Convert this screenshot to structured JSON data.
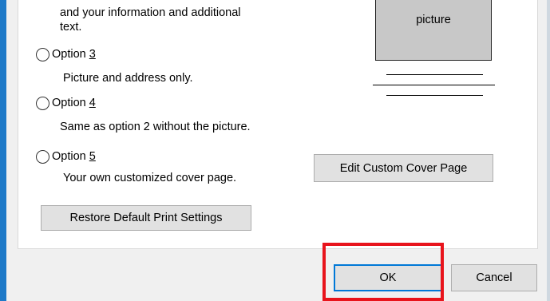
{
  "options": {
    "option2_desc_line1": "and your information and additional",
    "option2_desc_line2": "text.",
    "option3_prefix": "Option ",
    "option3_num": "3",
    "option3_desc": "Picture and address only.",
    "option4_prefix": "Option ",
    "option4_num": "4",
    "option4_desc": "Same as option 2 without the picture.",
    "option5_prefix": "Option ",
    "option5_num": "5",
    "option5_desc": "Your own customized cover page."
  },
  "preview": {
    "picture_label": "picture"
  },
  "buttons": {
    "edit_custom": "Edit Custom Cover Page",
    "restore_defaults": "Restore Default Print Settings",
    "ok": "OK",
    "cancel": "Cancel"
  },
  "colors": {
    "window_border": "#1e79c8",
    "focus_border": "#0078d7",
    "highlight": "#e8141c"
  }
}
